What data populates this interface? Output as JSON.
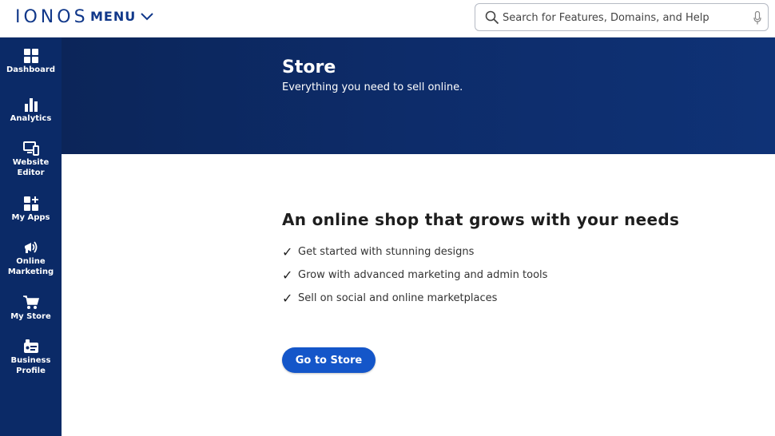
{
  "brand": {
    "logo_text": "IONOS",
    "primary": "#11388a",
    "sidebar_bg": "#0b2a67",
    "accent": "#1456c9"
  },
  "header": {
    "menu_label": "MENU",
    "menu_icon": "chevron-down-icon",
    "search": {
      "placeholder": "Search for Features, Domains, and Help",
      "value": "",
      "icon": "search-icon",
      "voice_icon": "microphone-icon"
    }
  },
  "sidebar": {
    "items": [
      {
        "id": "dashboard",
        "label": "Dashboard",
        "icon": "dashboard-grid-icon"
      },
      {
        "id": "analytics",
        "label": "Analytics",
        "icon": "bar-chart-icon"
      },
      {
        "id": "website-editor",
        "label": "Website Editor",
        "icon": "devices-icon"
      },
      {
        "id": "my-apps",
        "label": "My Apps",
        "icon": "apps-plus-icon"
      },
      {
        "id": "online-marketing",
        "label": "Online Marketing",
        "icon": "megaphone-icon"
      },
      {
        "id": "my-store",
        "label": "My Store",
        "icon": "shopping-cart-icon"
      },
      {
        "id": "business-profile",
        "label": "Business Profile",
        "icon": "business-card-icon"
      }
    ]
  },
  "hero": {
    "title": "Store",
    "subtitle": "Everything you need to sell online."
  },
  "main": {
    "headline": "An online shop that grows with your needs",
    "features": [
      "Get started with stunning designs",
      "Grow with advanced marketing and admin tools",
      "Sell on social and online marketplaces"
    ],
    "check_glyph": "✓",
    "cta_label": "Go to Store"
  }
}
